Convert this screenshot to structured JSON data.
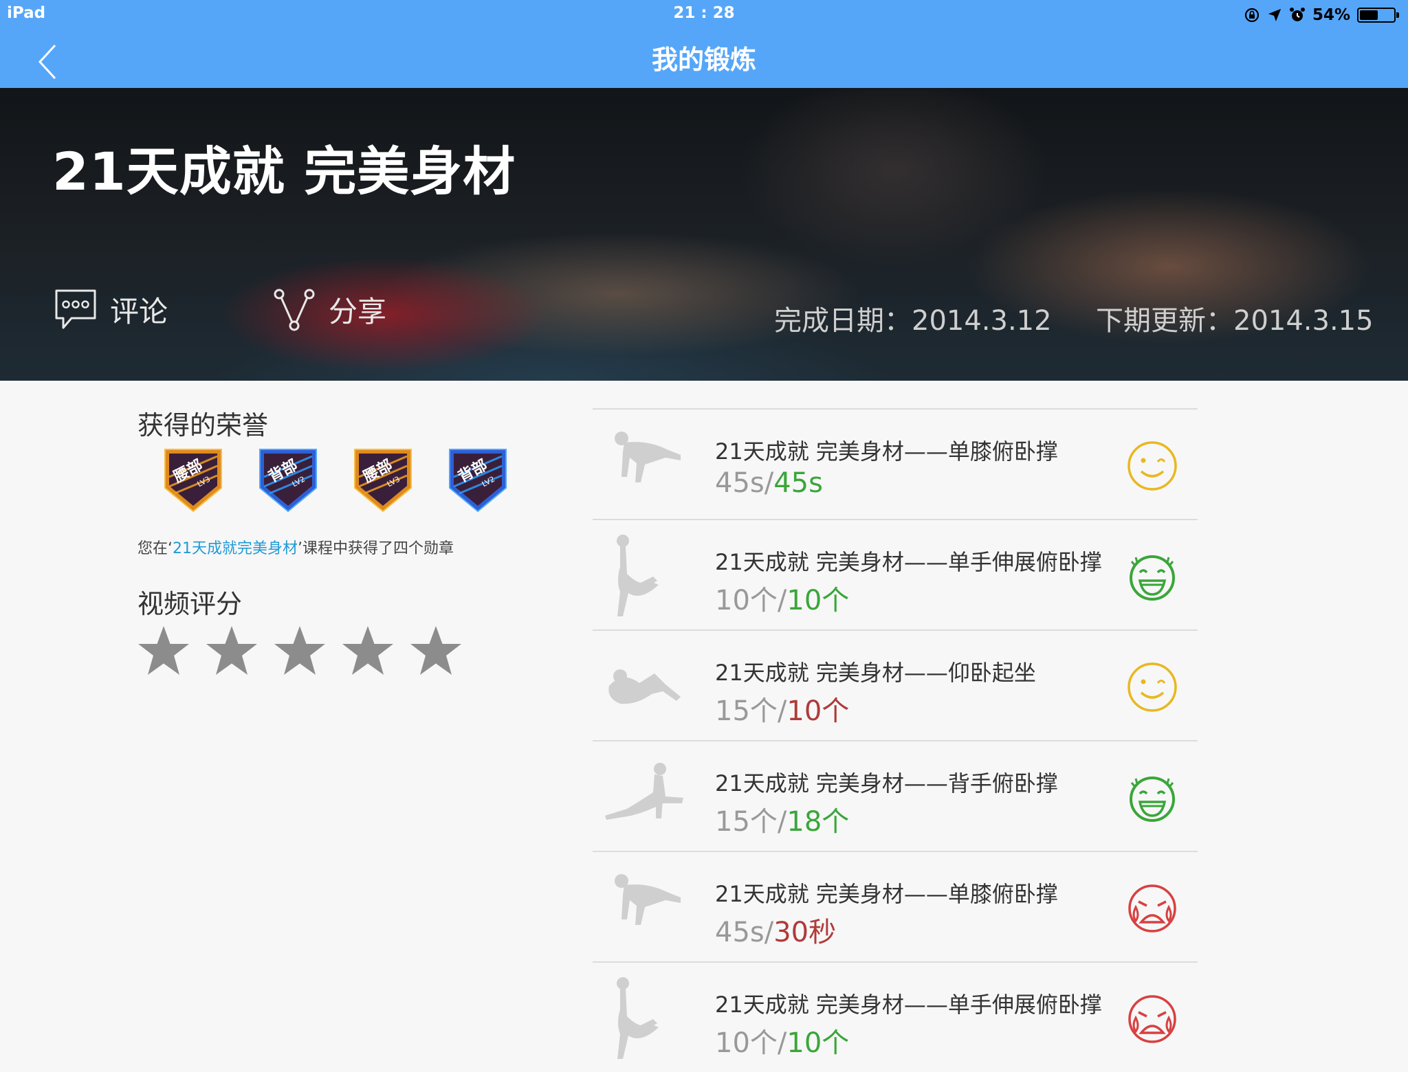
{
  "status_bar": {
    "device": "iPad",
    "time": "21 : 28",
    "battery": "54%",
    "battery_level": 0.54
  },
  "nav": {
    "title": "我的锻炼"
  },
  "hero": {
    "title": "21天成就 完美身材",
    "comment_label": "评论",
    "share_label": "分享",
    "completion_date": "完成日期：2014.3.12",
    "next_update": "下期更新：2014.3.15"
  },
  "honors": {
    "title": "获得的荣誉",
    "badges": [
      {
        "part": "腰部",
        "level": "LV3",
        "color": "orange"
      },
      {
        "part": "背部",
        "level": "LV2",
        "color": "blue"
      },
      {
        "part": "腰部",
        "level": "LV3",
        "color": "orange"
      },
      {
        "part": "背部",
        "level": "LV2",
        "color": "blue"
      }
    ],
    "desc_prefix": "您在‘",
    "desc_course": "21天成就完美身材",
    "desc_suffix": "’课程中获得了四个勋章"
  },
  "rating": {
    "title": "视频评分",
    "stars": 5,
    "star_color": "#8c8c8c"
  },
  "exercises": [
    {
      "name": "21天成就 完美身材——单膝俯卧撑",
      "target": "45s",
      "achieved": "45s",
      "status": "good",
      "face": "wink-face-icon",
      "pose": "kneeling-pushup"
    },
    {
      "name": "21天成就 完美身材——单手伸展俯卧撑",
      "target": "10个",
      "achieved": "10个",
      "status": "good",
      "face": "laughing-face-icon",
      "pose": "side-plank"
    },
    {
      "name": "21天成就 完美身材——仰卧起坐",
      "target": "15个",
      "achieved": "10个",
      "status": "bad",
      "face": "wink-face-icon",
      "pose": "situp"
    },
    {
      "name": "21天成就 完美身材——背手俯卧撑",
      "target": "15个",
      "achieved": "18个",
      "status": "good",
      "face": "laughing-face-icon",
      "pose": "reverse-pushup"
    },
    {
      "name": "21天成就 完美身材——单膝俯卧撑",
      "target": "45s",
      "achieved": "30秒",
      "status": "bad",
      "face": "crying-face-icon",
      "pose": "kneeling-pushup"
    },
    {
      "name": "21天成就 完美身材——单手伸展俯卧撑",
      "target": "10个",
      "achieved": "10个",
      "status": "good",
      "face": "crying-face-icon",
      "pose": "side-plank"
    }
  ],
  "colors": {
    "nav_bg": "#55a6f9",
    "good": "#3aa63a",
    "bad": "#b03a3a",
    "wink": "#e8b820",
    "laugh": "#3aa63a",
    "cry": "#d84040"
  }
}
